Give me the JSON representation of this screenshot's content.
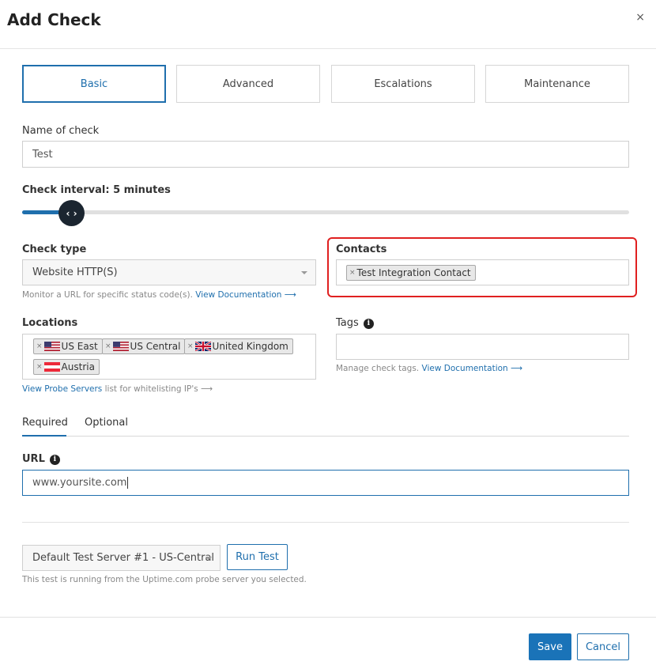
{
  "dialog": {
    "title": "Add Check",
    "close": "×"
  },
  "tabs": [
    "Basic",
    "Advanced",
    "Escalations",
    "Maintenance"
  ],
  "name_of_check": {
    "label": "Name of check",
    "value": "Test"
  },
  "check_interval": {
    "label": "Check interval: 5 minutes",
    "handle": "‹ ›"
  },
  "check_type": {
    "label": "Check type",
    "value": "Website HTTP(S)",
    "help": "Monitor a URL for specific status code(s).",
    "link": "View Documentation ⟶"
  },
  "contacts": {
    "label": "Contacts",
    "chips": [
      "Test Integration Contact"
    ]
  },
  "locations": {
    "label": "Locations",
    "chips": [
      "US East",
      "US Central",
      "United Kingdom",
      "Austria"
    ],
    "link": "View Probe Servers",
    "help": "list for whitelisting IP's ⟶"
  },
  "tags": {
    "label": "Tags",
    "help": "Manage check tags.",
    "link": "View Documentation ⟶"
  },
  "subtabs": [
    "Required",
    "Optional"
  ],
  "url": {
    "label": "URL",
    "value": "www.yoursite.com"
  },
  "test_server": {
    "value": "Default Test Server #1 - US-Central",
    "run_label": "Run Test",
    "help": "This test is running from the Uptime.com probe server you selected."
  },
  "footer": {
    "save": "Save",
    "cancel": "Cancel"
  },
  "colors": {
    "accent": "#1f6fad",
    "highlight": "#e02020",
    "primary": "#1a73b8"
  }
}
